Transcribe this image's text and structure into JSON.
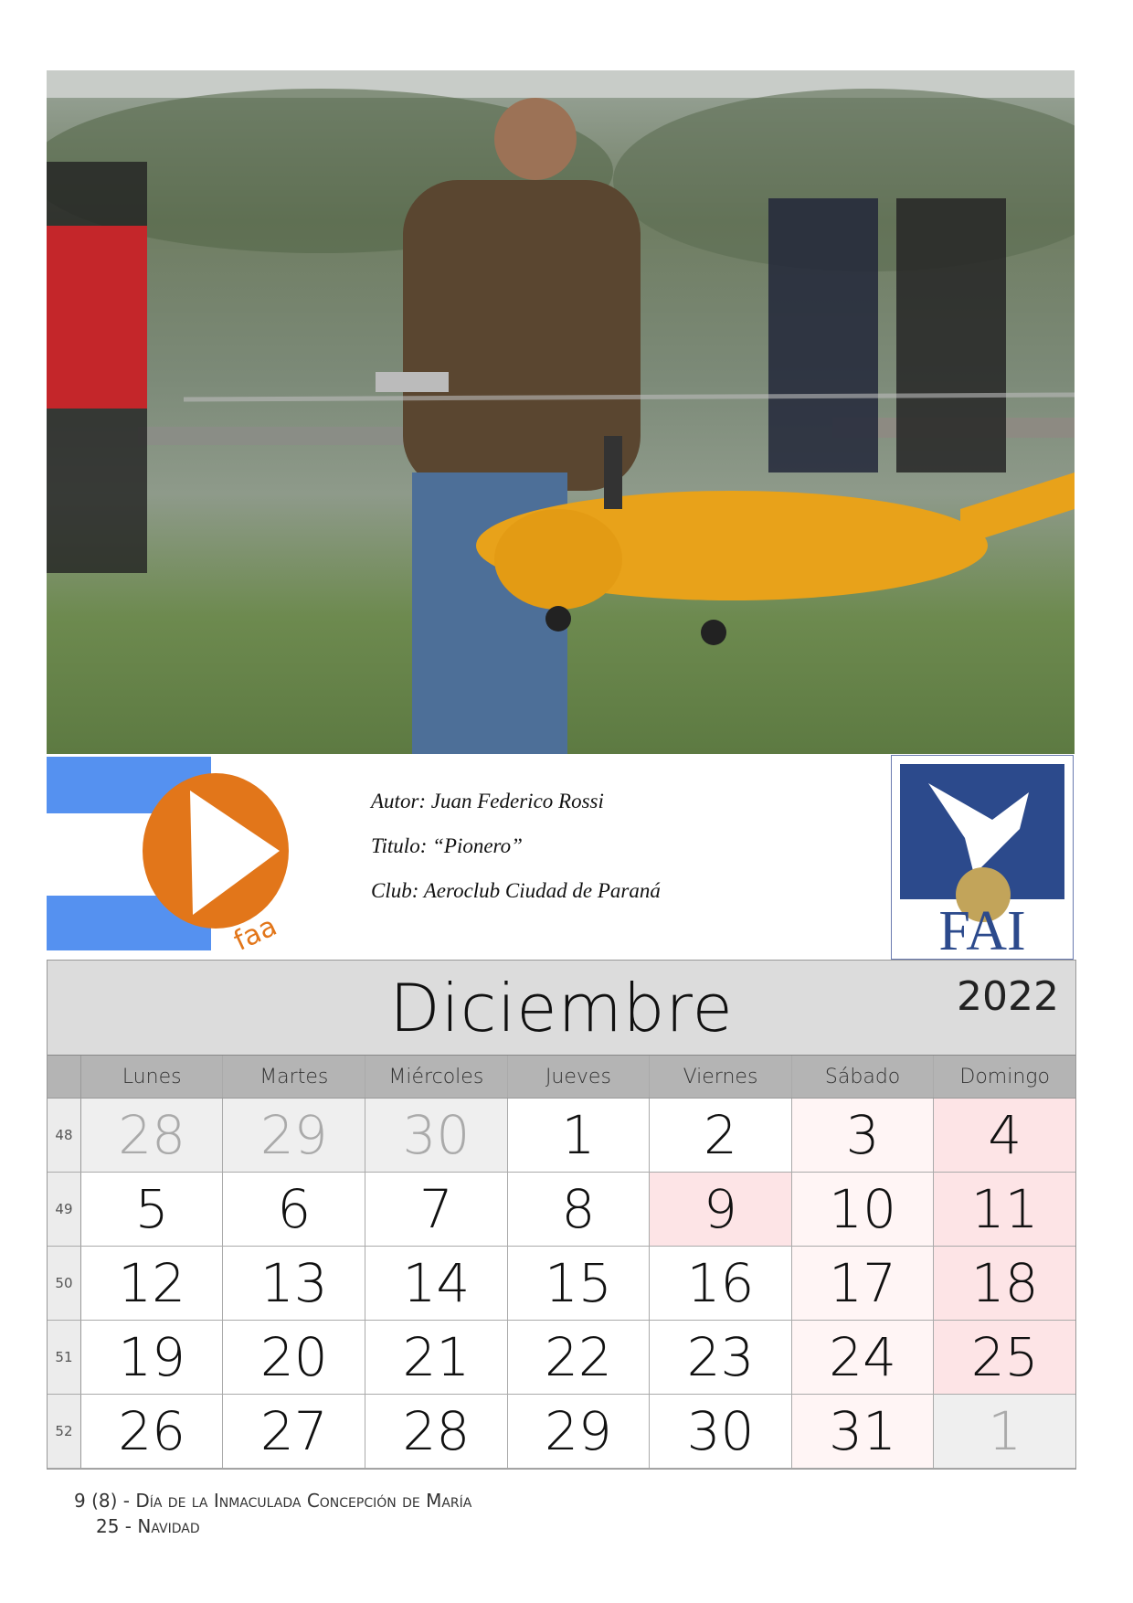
{
  "credits": {
    "author": "Autor: Juan Federico Rossi",
    "title": "Titulo:  “Pionero”",
    "club": "Club:  Aeroclub Ciudad de Paraná"
  },
  "logos": {
    "left": "faa",
    "right": "FAI"
  },
  "calendar": {
    "month": "Diciembre",
    "year": "2022",
    "weekdays": [
      "Lunes",
      "Martes",
      "Miércoles",
      "Jueves",
      "Viernes",
      "Sábado",
      "Domingo"
    ],
    "weeks": [
      {
        "number": "48",
        "days": [
          "28",
          "29",
          "30",
          "1",
          "2",
          "3",
          "4"
        ],
        "types": [
          "other",
          "other",
          "other",
          "",
          "",
          "sat",
          "hol"
        ]
      },
      {
        "number": "49",
        "days": [
          "5",
          "6",
          "7",
          "8",
          "9",
          "10",
          "11"
        ],
        "types": [
          "",
          "",
          "",
          "",
          "hol",
          "sat",
          "hol"
        ]
      },
      {
        "number": "50",
        "days": [
          "12",
          "13",
          "14",
          "15",
          "16",
          "17",
          "18"
        ],
        "types": [
          "",
          "",
          "",
          "",
          "",
          "sat",
          "hol"
        ]
      },
      {
        "number": "51",
        "days": [
          "19",
          "20",
          "21",
          "22",
          "23",
          "24",
          "25"
        ],
        "types": [
          "",
          "",
          "",
          "",
          "",
          "sat",
          "hol"
        ]
      },
      {
        "number": "52",
        "days": [
          "26",
          "27",
          "28",
          "29",
          "30",
          "31",
          "1"
        ],
        "types": [
          "",
          "",
          "",
          "",
          "",
          "sat",
          "other"
        ]
      }
    ]
  },
  "notes": [
    "9 (8) - Día de la Inmaculada Concepción de María",
    "25 - Navidad"
  ],
  "colors": {
    "holiday": "#fde4e6",
    "saturday": "#fff5f5",
    "other_month": "#efefef",
    "header": "#dcdcdc",
    "helicopter": "#e8a21a"
  }
}
